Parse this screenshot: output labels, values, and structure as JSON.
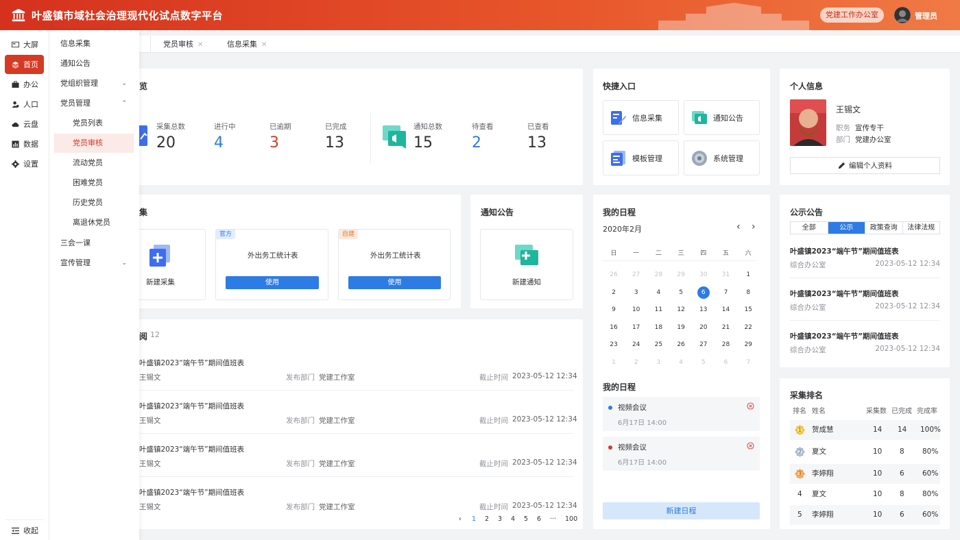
{
  "header": {
    "title": "叶盛镇市域社会治理现代化试点数字平台",
    "office": "党建工作办公室",
    "user": "管理员",
    "bg_color": "#d5311e"
  },
  "rail": {
    "items": [
      {
        "label": "大屏",
        "icon": "screen-icon"
      },
      {
        "label": "首页",
        "icon": "layers-icon",
        "active": true
      },
      {
        "label": "办公",
        "icon": "briefcase-icon"
      },
      {
        "label": "人口",
        "icon": "people-icon"
      },
      {
        "label": "云盘",
        "icon": "cloud-icon"
      },
      {
        "label": "数据",
        "icon": "chart-icon"
      },
      {
        "label": "设置",
        "icon": "gear-icon"
      }
    ],
    "collapse": "收起",
    "accent": "#d53a25"
  },
  "submenu": {
    "items": [
      {
        "label": "信息采集"
      },
      {
        "label": "通知公告"
      },
      {
        "label": "党组织管理",
        "chev": "⌄"
      },
      {
        "label": "党员管理",
        "chev": "⌃"
      },
      {
        "label": "党员列表"
      },
      {
        "label": "党员审核"
      },
      {
        "label": "流动党员"
      },
      {
        "label": "困难党员"
      },
      {
        "label": "历史党员"
      },
      {
        "label": "离退休党员"
      },
      {
        "label": "三会一课"
      },
      {
        "label": "宣传管理",
        "chev": "⌄"
      }
    ]
  },
  "tabs": [
    {
      "label": "党员审核",
      "close": "✕"
    },
    {
      "label": "信息采集",
      "close": "✕"
    }
  ],
  "overview": {
    "title": "览",
    "collect": {
      "items": [
        {
          "label": "采集总数",
          "value": "20"
        },
        {
          "label": "进行中",
          "value": "4"
        },
        {
          "label": "已逾期",
          "value": "3"
        },
        {
          "label": "已完成",
          "value": "13"
        }
      ]
    },
    "notice": {
      "items": [
        {
          "label": "通知总数",
          "value": "15"
        },
        {
          "label": "待查看",
          "value": "2"
        },
        {
          "label": "已查看",
          "value": "13"
        }
      ]
    }
  },
  "quick": {
    "title": "快捷入口",
    "items": [
      {
        "label": "信息采集",
        "icon": "form-edit-icon"
      },
      {
        "label": "通知公告",
        "icon": "announcement-icon"
      },
      {
        "label": "模板管理",
        "icon": "template-icon"
      },
      {
        "label": "系统管理",
        "icon": "system-disc-icon"
      }
    ]
  },
  "profile": {
    "title": "个人信息",
    "name": "王锡文",
    "position_label": "职务",
    "position": "宣传专干",
    "dept_label": "部门",
    "dept": "党建办公室",
    "edit": "编辑个人资料"
  },
  "collect_section": {
    "title": "集",
    "new_label": "新建采集",
    "templates": [
      {
        "tag": "官方",
        "title": "外出务工统计表",
        "button": "使用"
      },
      {
        "tag": "自建",
        "title": "外出务工统计表",
        "button": "使用"
      }
    ]
  },
  "notice_card": {
    "title": "通知公告",
    "new_label": "新建通知"
  },
  "calendar": {
    "title": "我的日程",
    "month": "2020年2月",
    "prev": "‹",
    "next": "›",
    "weekdays": [
      "日",
      "一",
      "二",
      "三",
      "四",
      "五",
      "六"
    ],
    "weeks": [
      [
        "26",
        "27",
        "28",
        "29",
        "30",
        "31",
        "1"
      ],
      [
        "2",
        "3",
        "4",
        "5",
        "6",
        "7",
        "8"
      ],
      [
        "9",
        "10",
        "11",
        "12",
        "13",
        "14",
        "15"
      ],
      [
        "16",
        "17",
        "18",
        "19",
        "20",
        "21",
        "22"
      ],
      [
        "23",
        "24",
        "25",
        "26",
        "27",
        "28",
        "29"
      ],
      [
        "1",
        "2",
        "3",
        "4",
        "5",
        "6",
        "7"
      ]
    ],
    "today": "6"
  },
  "schedule": {
    "title": "我的日程",
    "items": [
      {
        "title": "视频会议",
        "time": "6月17日 14:00",
        "color": "#2d7be5"
      },
      {
        "title": "视频会议",
        "time": "6月17日 14:00",
        "color": "#d53a25"
      }
    ],
    "new_label": "新建日程"
  },
  "public_notice": {
    "title": "公示公告",
    "tabs": [
      "全部",
      "公示",
      "政策查询",
      "法律法规"
    ],
    "active_tab": "公示",
    "items": [
      {
        "title": "叶盛镇2023“端午节”期间值班表",
        "dept": "综合办公室",
        "time": "2023-05-12 12:34"
      },
      {
        "title": "叶盛镇2023“端午节”期间值班表",
        "dept": "综合办公室",
        "time": "2023-05-12 12:34"
      },
      {
        "title": "叶盛镇2023“端午节”期间值班表",
        "dept": "综合办公室",
        "time": "2023-05-12 12:34"
      }
    ]
  },
  "ranking": {
    "title": "采集排名",
    "headers": [
      "排名",
      "姓名",
      "采集数",
      "已完成",
      "完成率"
    ],
    "rows": [
      {
        "rank": "1",
        "name": "贺成慧",
        "count": "14",
        "done": "14",
        "rate": "100%",
        "medal": "gold"
      },
      {
        "rank": "2",
        "name": "夏文",
        "count": "10",
        "done": "8",
        "rate": "80%",
        "medal": "silver"
      },
      {
        "rank": "3",
        "name": "李婷翔",
        "count": "10",
        "done": "6",
        "rate": "60%",
        "medal": "bronze"
      },
      {
        "rank": "4",
        "name": "夏文",
        "count": "10",
        "done": "8",
        "rate": "80%"
      },
      {
        "rank": "5",
        "name": "李婷翔",
        "count": "10",
        "done": "6",
        "rate": "60%"
      }
    ]
  },
  "pending": {
    "title": "阅",
    "count": "12",
    "items": [
      {
        "title": "叶盛镇2023“端午节”期间值班表",
        "person": "王锡文",
        "dept_label": "发布部门",
        "dept": "党建工作室",
        "deadline_label": "截止时间",
        "deadline": "2023-05-12 12:34"
      },
      {
        "title": "叶盛镇2023“端午节”期间值班表",
        "person": "王锡文",
        "dept_label": "发布部门",
        "dept": "党建工作室",
        "deadline_label": "截止时间",
        "deadline": "2023-05-12 12:34"
      },
      {
        "title": "叶盛镇2023“端午节”期间值班表",
        "person": "王锡文",
        "dept_label": "发布部门",
        "dept": "党建工作室",
        "deadline_label": "截止时间",
        "deadline": "2023-05-12 12:34"
      },
      {
        "title": "叶盛镇2023“端午节”期间值班表",
        "person": "王锡文",
        "dept_label": "发布部门",
        "dept": "党建工作室",
        "deadline_label": "截止时间",
        "deadline": "2023-05-12 12:34"
      }
    ],
    "pager": [
      "‹",
      "1",
      "2",
      "3",
      "4",
      "5",
      "6",
      "···",
      "100"
    ]
  }
}
